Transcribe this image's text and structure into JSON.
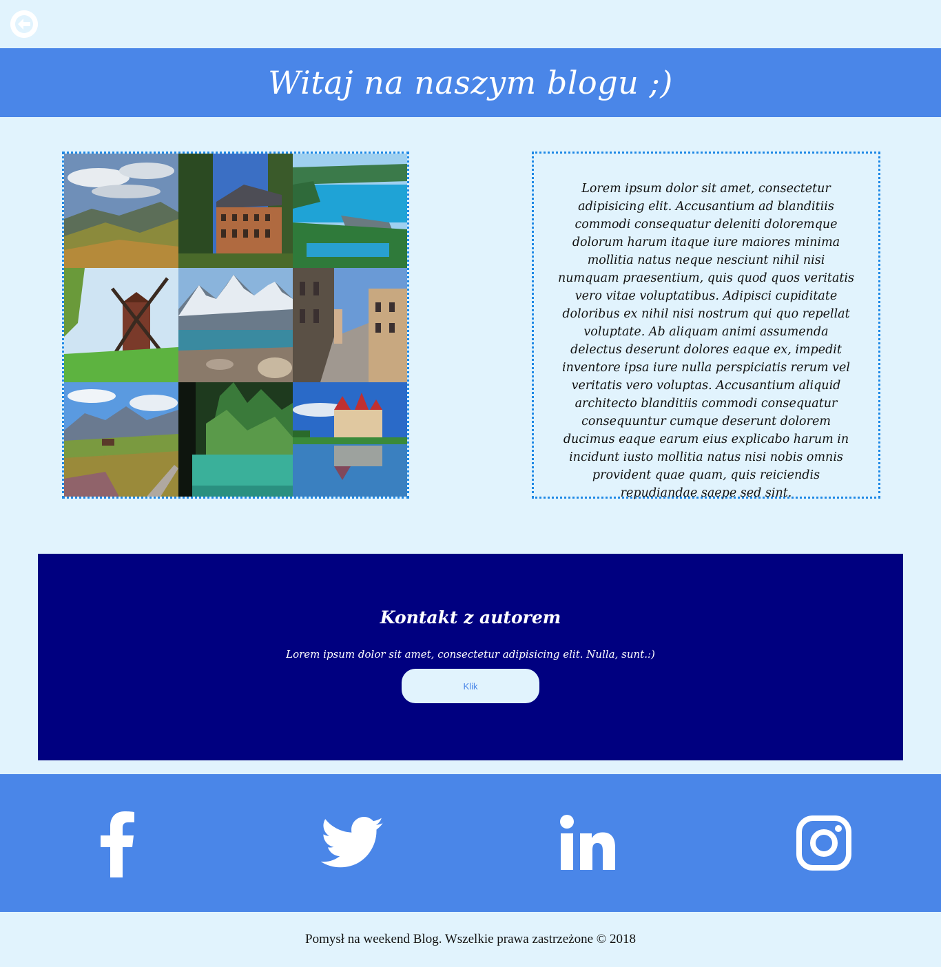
{
  "header": {
    "title": "Witaj na naszym blogu ;)"
  },
  "nav": {
    "back_icon": "arrow-left-circle-icon"
  },
  "gallery": {
    "images": [
      "mountain-landscape",
      "old-palace",
      "lake-dam",
      "windmill",
      "mountain-lake",
      "city-street",
      "mountain-valley-hut",
      "forest-lake",
      "castle-reflection"
    ]
  },
  "article": {
    "text": "Lorem ipsum dolor sit amet, consectetur adipisicing elit. Accusantium ad blanditiis commodi consequatur deleniti doloremque dolorum harum itaque iure maiores minima mollitia natus neque nesciunt nihil nisi numquam praesentium, quis quod quos veritatis vero vitae voluptatibus. Adipisci cupiditate doloribus ex nihil nisi nostrum qui quo repellat voluptate. Ab aliquam animi assumenda delectus deserunt dolores eaque ex, impedit inventore ipsa iure nulla perspiciatis rerum vel veritatis vero voluptas. Accusantium aliquid architecto blanditiis commodi consequatur consequuntur cumque deserunt dolorem ducimus eaque earum eius explicabo harum in incidunt iusto mollitia natus nisi nobis omnis provident quae quam, quis reiciendis repudiandae saepe sed sint."
  },
  "contact": {
    "title": "Kontakt z autorem",
    "text": "Lorem ipsum dolor sit amet, consectetur adipisicing elit. Nulla, sunt.:)",
    "button_label": "Klik"
  },
  "social": {
    "icons": [
      "facebook-icon",
      "twitter-icon",
      "linkedin-icon",
      "instagram-icon"
    ]
  },
  "footer": {
    "text": "Pomysł na weekend Blog. Wszelkie prawa zastrzeżone © 2018"
  },
  "colors": {
    "background": "#e1f3fd",
    "header": "#4a86e8",
    "contact_bg": "#000080",
    "border": "#1e88e5"
  }
}
